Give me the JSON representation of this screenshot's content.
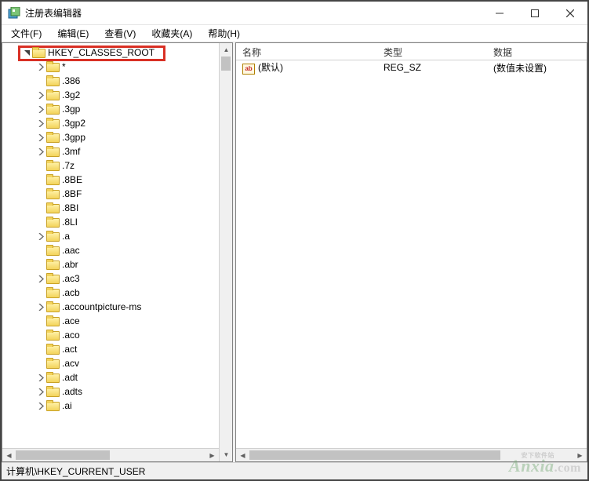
{
  "window": {
    "title": "注册表编辑器"
  },
  "menu": {
    "items": [
      "文件(F)",
      "编辑(E)",
      "查看(V)",
      "收藏夹(A)",
      "帮助(H)"
    ]
  },
  "tree": {
    "root": {
      "label": "HKEY_CLASSES_ROOT",
      "expanded": true
    },
    "children": [
      {
        "label": "*",
        "chevron": "closed"
      },
      {
        "label": ".386",
        "chevron": "none"
      },
      {
        "label": ".3g2",
        "chevron": "closed"
      },
      {
        "label": ".3gp",
        "chevron": "closed"
      },
      {
        "label": ".3gp2",
        "chevron": "closed"
      },
      {
        "label": ".3gpp",
        "chevron": "closed"
      },
      {
        "label": ".3mf",
        "chevron": "closed"
      },
      {
        "label": ".7z",
        "chevron": "none"
      },
      {
        "label": ".8BE",
        "chevron": "none"
      },
      {
        "label": ".8BF",
        "chevron": "none"
      },
      {
        "label": ".8BI",
        "chevron": "none"
      },
      {
        "label": ".8LI",
        "chevron": "none"
      },
      {
        "label": ".a",
        "chevron": "closed"
      },
      {
        "label": ".aac",
        "chevron": "none"
      },
      {
        "label": ".abr",
        "chevron": "none"
      },
      {
        "label": ".ac3",
        "chevron": "closed"
      },
      {
        "label": ".acb",
        "chevron": "none"
      },
      {
        "label": ".accountpicture-ms",
        "chevron": "closed"
      },
      {
        "label": ".ace",
        "chevron": "none"
      },
      {
        "label": ".aco",
        "chevron": "none"
      },
      {
        "label": ".act",
        "chevron": "none"
      },
      {
        "label": ".acv",
        "chevron": "none"
      },
      {
        "label": ".adt",
        "chevron": "closed"
      },
      {
        "label": ".adts",
        "chevron": "closed"
      },
      {
        "label": ".ai",
        "chevron": "closed"
      }
    ]
  },
  "list": {
    "headers": {
      "name": "名称",
      "type": "类型",
      "data": "数据"
    },
    "rows": [
      {
        "name": "(默认)",
        "type": "REG_SZ",
        "data": "(数值未设置)"
      }
    ]
  },
  "statusbar": {
    "path": "计算机\\HKEY_CURRENT_USER"
  },
  "watermark": {
    "brand": "Anxia",
    "suffix": ".com",
    "tag": "安下软件站"
  }
}
